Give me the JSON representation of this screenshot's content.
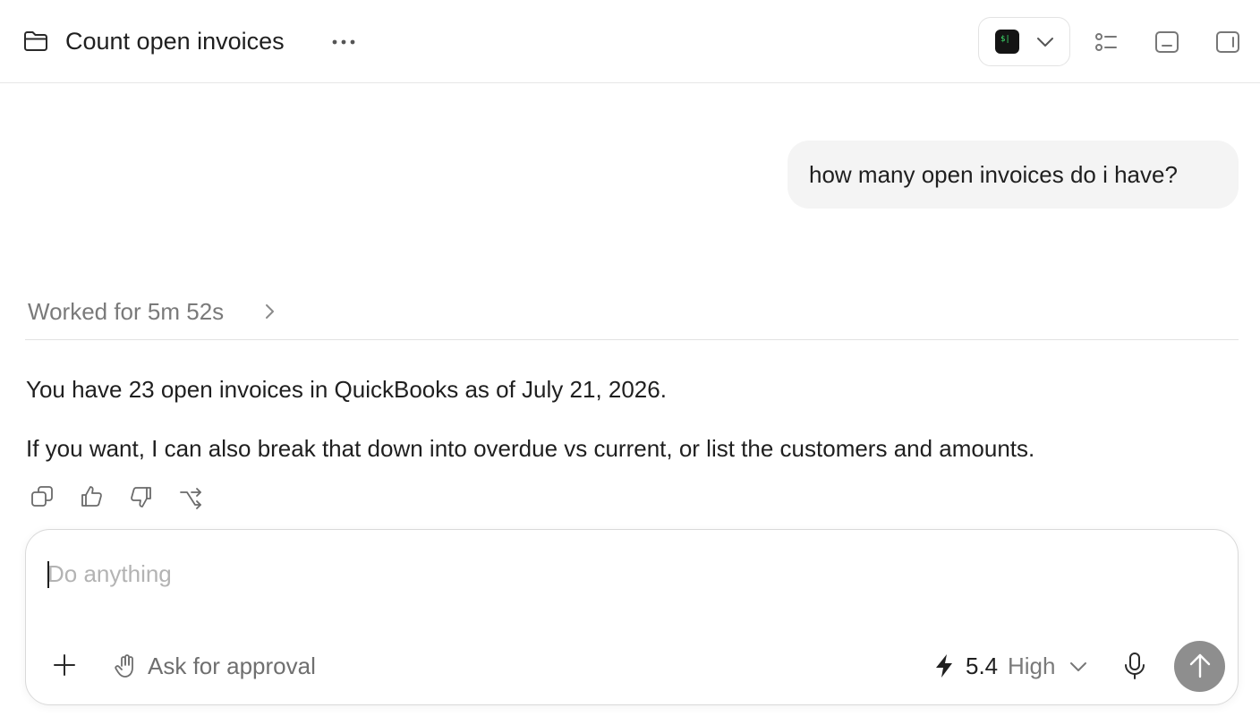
{
  "header": {
    "title": "Count open invoices",
    "environment": {
      "terminal_glyph": "$|"
    }
  },
  "conversation": {
    "user_message": "how many open invoices do i have?",
    "worked_label": "Worked for 5m 52s",
    "response": [
      "You have 23 open invoices in QuickBooks as of July 21, 2026.",
      "If you want, I can also break that down into overdue vs current, or list the customers and amounts."
    ]
  },
  "composer": {
    "placeholder": "Do anything",
    "value": "",
    "approval_label": "Ask for approval",
    "model_version": "5.4",
    "model_level": "High"
  },
  "icons": {
    "header": [
      "folder-icon",
      "more-icon",
      "terminal-icon",
      "chevron-down-icon",
      "task-list-icon",
      "bottom-panel-icon",
      "sidebar-right-icon"
    ],
    "actions": [
      "copy-icon",
      "thumbs-up-icon",
      "thumbs-down-icon",
      "fork-icon"
    ],
    "composer": [
      "plus-icon",
      "hand-icon",
      "bolt-icon",
      "chevron-down-icon",
      "mic-icon",
      "arrow-up-icon"
    ]
  },
  "colors": {
    "send_button": "#8e8e8e",
    "user_bubble": "#f4f4f4",
    "terminal_bg": "#141414",
    "terminal_fg": "#3ee36d"
  }
}
